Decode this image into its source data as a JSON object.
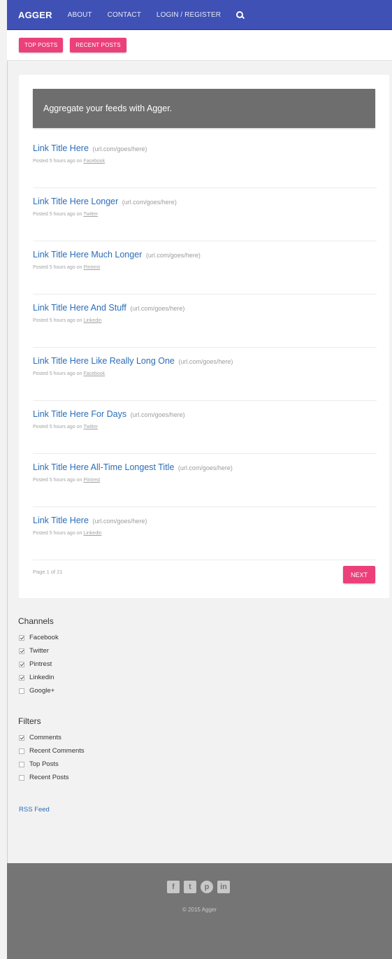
{
  "nav": {
    "brand": "AGGER",
    "links": [
      "ABOUT",
      "CONTACT",
      "LOGIN / REGISTER"
    ],
    "search_icon": "search-icon"
  },
  "top_buttons": [
    "TOP POSTS",
    "RECENT POSTS"
  ],
  "banner": "Aggregate your feeds with Agger.",
  "links": [
    {
      "title": "Link Title Here",
      "url": "(url.com/goes/here)",
      "meta": "Posted 5 hours ago on",
      "source": "Facebook"
    },
    {
      "title": "Link Title Here Longer",
      "url": "(url.com/goes/here)",
      "meta": "Posted 5 hours ago on",
      "source": "Twitter"
    },
    {
      "title": "Link Title Here Much Longer",
      "url": "(url.com/goes/here)",
      "meta": "Posted 5 hours ago on",
      "source": "Pintrest"
    },
    {
      "title": "Link Title Here And Stuff",
      "url": "(url.com/goes/here)",
      "meta": "Posted 5 hours ago on",
      "source": "Linkedin"
    },
    {
      "title": "Link Title Here Like Really Long One",
      "url": "(url.com/goes/here)",
      "meta": "Posted 5 hours ago on",
      "source": "Facebook"
    },
    {
      "title": "Link Title Here For Days",
      "url": "(url.com/goes/here)",
      "meta": "Posted 5 hours ago on",
      "source": "Twitter"
    },
    {
      "title": "Link Title Here All-Time Longest Title",
      "url": "(url.com/goes/here)",
      "meta": "Posted 5 hours ago on",
      "source": "Pintrest"
    },
    {
      "title": "Link Title Here",
      "url": "(url.com/goes/here)",
      "meta": "Posted 5 hours ago on",
      "source": "Linkedin"
    }
  ],
  "pagination": {
    "info": "Page 1 of 21",
    "next": "NEXT"
  },
  "channels": {
    "title": "Channels",
    "items": [
      {
        "label": "Facebook",
        "checked": true
      },
      {
        "label": "Twitter",
        "checked": true
      },
      {
        "label": "Pintrest",
        "checked": true
      },
      {
        "label": "Linkedin",
        "checked": true
      },
      {
        "label": "Google+",
        "checked": false
      }
    ]
  },
  "filters": {
    "title": "Filters",
    "items": [
      {
        "label": "Comments",
        "checked": true
      },
      {
        "label": "Recent Comments",
        "checked": false
      },
      {
        "label": "Top Posts",
        "checked": false
      },
      {
        "label": "Recent Posts",
        "checked": false
      }
    ]
  },
  "rss": "RSS Feed",
  "footer": {
    "social_icons": [
      "facebook-icon",
      "twitter-icon",
      "pinterest-icon",
      "linkedin-icon"
    ],
    "copyright": "© 2015 Agger"
  },
  "colors": {
    "nav": "#3f51b5",
    "accent": "#ec407a",
    "link": "#2a6db8",
    "banner": "#6e6e6e",
    "footer": "#757575"
  }
}
